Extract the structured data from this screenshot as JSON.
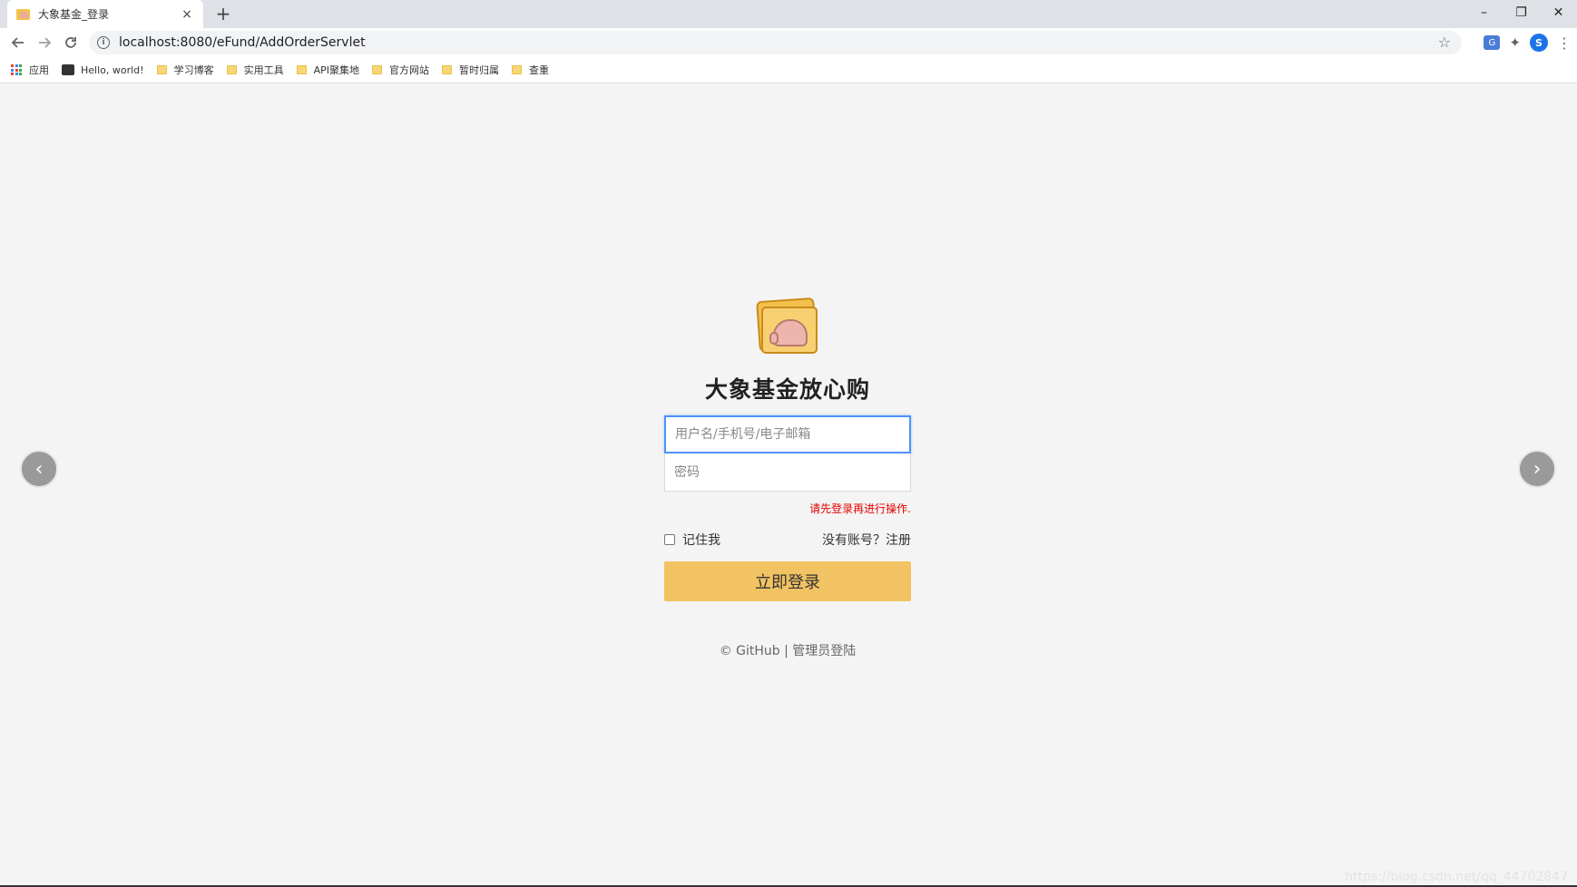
{
  "browser": {
    "tab_title": "大象基金_登录",
    "tab_close": "×",
    "new_tab": "+",
    "url": "localhost:8080/eFund/AddOrderServlet",
    "avatar_letter": "S",
    "window_controls": [
      "–",
      "❐",
      "✕"
    ],
    "icons": [
      "back-icon",
      "forward-icon",
      "reload-icon",
      "info-icon",
      "star-icon",
      "translate-icon",
      "puzzle-icon",
      "menu-icon"
    ]
  },
  "bookmarks": [
    {
      "label": "应用",
      "icon": "apps-icon"
    },
    {
      "label": "Hello, world!",
      "icon": "site-icon"
    },
    {
      "label": "学习博客",
      "icon": "folder-icon"
    },
    {
      "label": "实用工具",
      "icon": "folder-icon"
    },
    {
      "label": "API聚集地",
      "icon": "folder-icon"
    },
    {
      "label": "官方网站",
      "icon": "folder-icon"
    },
    {
      "label": "暂时归属",
      "icon": "folder-icon"
    },
    {
      "label": "查重",
      "icon": "folder-icon"
    }
  ],
  "login": {
    "title": "大象基金放心购",
    "username_placeholder": "用户名/手机号/电子邮箱",
    "password_placeholder": "密码",
    "error": "请先登录再进行操作.",
    "remember": "记住我",
    "register": "没有账号？注册",
    "submit": "立即登录",
    "footer_github": "© GitHub",
    "footer_sep": " | ",
    "footer_admin": "管理员登陆"
  },
  "carousel": {
    "prev": "‹",
    "next": "›"
  },
  "watermark": "https://blog.csdn.net/qq_44702847",
  "colors": {
    "accent": "#f2c362",
    "error": "#e60000",
    "focus": "#4d90fe"
  }
}
